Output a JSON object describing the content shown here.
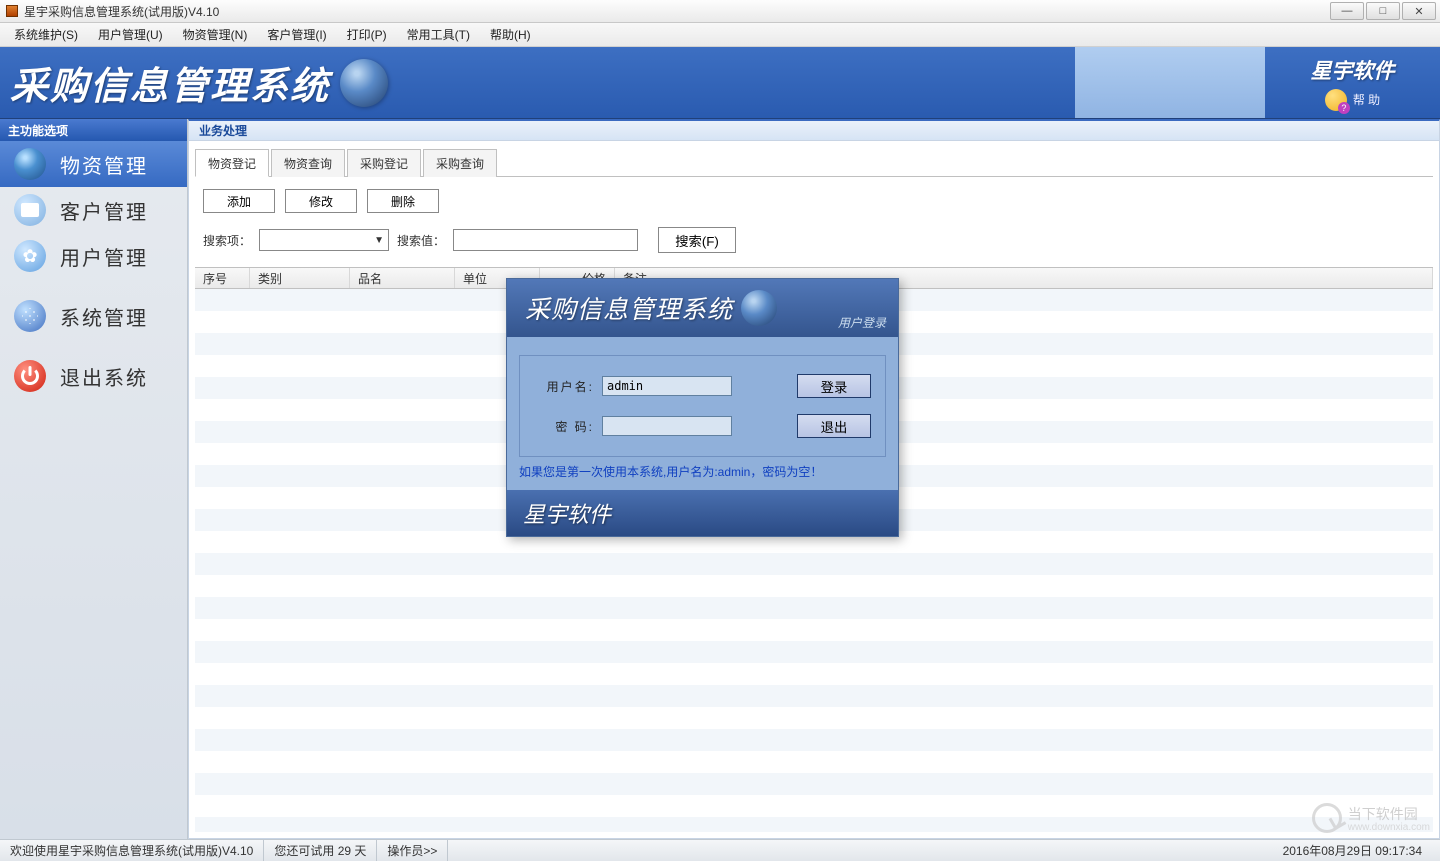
{
  "window": {
    "title": "星宇采购信息管理系统(试用版)V4.10"
  },
  "menubar": [
    "系统维护(S)",
    "用户管理(U)",
    "物资管理(N)",
    "客户管理(I)",
    "打印(P)",
    "常用工具(T)",
    "帮助(H)"
  ],
  "banner": {
    "title": "采购信息管理系统",
    "brand": "星宇软件",
    "help": "帮 助"
  },
  "sidebar": {
    "header": "主功能选项",
    "items": [
      {
        "label": "物资管理"
      },
      {
        "label": "客户管理"
      },
      {
        "label": "用户管理"
      },
      {
        "label": "系统管理"
      },
      {
        "label": "退出系统"
      }
    ]
  },
  "section": {
    "title": "业务处理"
  },
  "tabs": [
    "物资登记",
    "物资查询",
    "采购登记",
    "采购查询"
  ],
  "toolbar": {
    "add": "添加",
    "edit": "修改",
    "del": "删除"
  },
  "search": {
    "term_label": "搜索项：",
    "value_label": "搜索值：",
    "btn": "搜索(F)"
  },
  "grid": {
    "cols": [
      "序号",
      "类别",
      "品名",
      "单位",
      "价格",
      "备注"
    ]
  },
  "login": {
    "title": "采购信息管理系统",
    "subtitle": "用户登录",
    "user_label": "用户名:",
    "user_value": "admin",
    "pass_label": "密  码:",
    "login_btn": "登录",
    "exit_btn": "退出",
    "hint": "如果您是第一次使用本系统,用户名为:admin，密码为空！",
    "footer": "星宇软件"
  },
  "status": {
    "welcome": "欢迎使用星宇采购信息管理系统(试用版)V4.10",
    "trial": "您还可试用 29 天",
    "operator": "操作员>>",
    "datetime": "2016年08月29日 09:17:34"
  },
  "corner": {
    "brand": "当下软件园",
    "sub": "www.downxia.com"
  }
}
